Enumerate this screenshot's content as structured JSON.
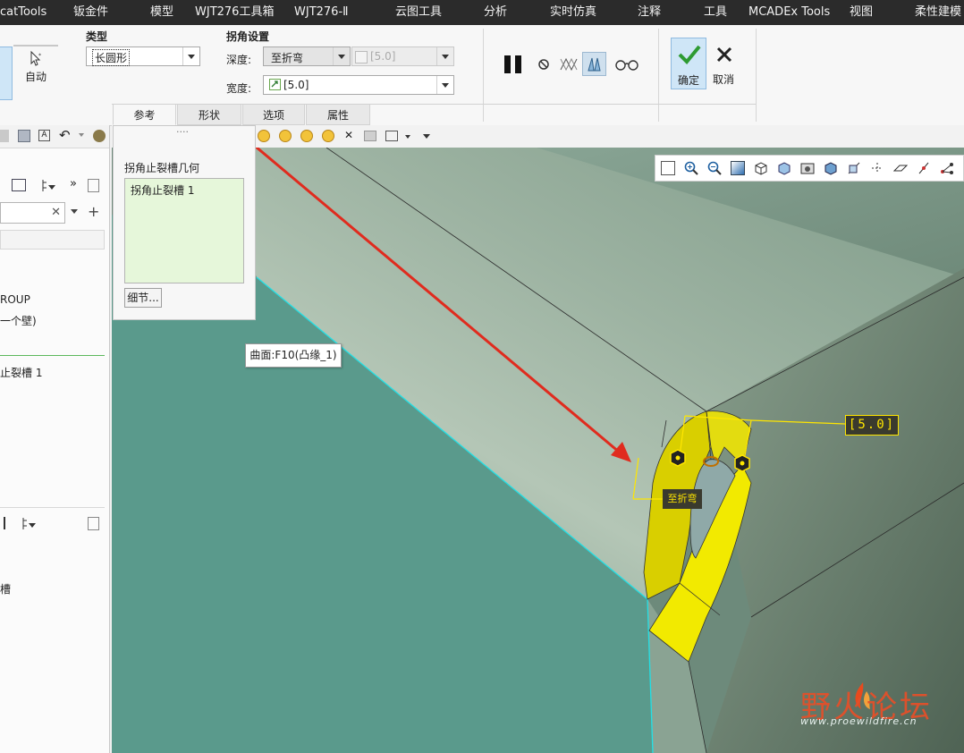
{
  "menubar": {
    "items": [
      "catTools",
      "钣金件",
      "模型",
      "WJT276工具箱",
      "WJT276-Ⅱ",
      "云图工具",
      "分析",
      "实时仿真",
      "注释",
      "工具",
      "MCADEx Tools",
      "视图",
      "柔性建模"
    ]
  },
  "ribbon": {
    "auto_label": "自动",
    "type_group": {
      "title": "类型",
      "value": "长圆形"
    },
    "corner_group": {
      "title": "拐角设置",
      "depth_label": "深度:",
      "depth_value": "至折弯",
      "depth_dim_value": "[5.0]",
      "width_label": "宽度:",
      "width_value": "[5.0]"
    },
    "confirm_label": "确定",
    "cancel_label": "取消",
    "tabs": [
      "参考",
      "形状",
      "选项",
      "属性"
    ]
  },
  "tree": {
    "items": [
      "ROUP",
      "一个壁)",
      "止裂槽 1",
      "槽"
    ]
  },
  "panel": {
    "handle": "····",
    "title": "拐角止裂槽几何",
    "list_item": "拐角止裂槽 1",
    "details_button": "细节..."
  },
  "tooltip": {
    "text": "曲面:F10(凸缘_1)"
  },
  "model": {
    "dim_width": "[5.0]",
    "dim_depth": "至折弯"
  },
  "watermark": {
    "brand": "野火论坛",
    "url": "www.proewildfire.cn"
  },
  "colors": {
    "menubar_bg": "#2b2b2b",
    "model_flat": "#5a9a8c",
    "model_round": "#a6bcaa",
    "relief_yellow": "#e8e000",
    "arrow_red": "#e02b1e",
    "confirm_bg": "#cfe6f7"
  }
}
